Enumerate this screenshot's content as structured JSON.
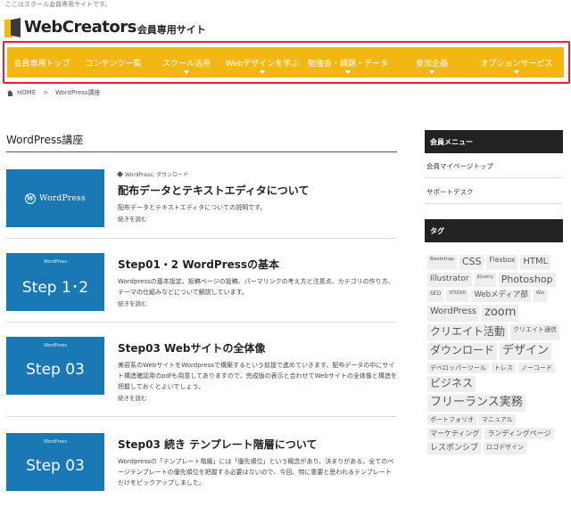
{
  "site": {
    "top_note": "ここはスクール会員専用サイトです。",
    "logo_main": "WebCreators",
    "logo_sub": "会員専用サイト"
  },
  "nav": {
    "items": [
      {
        "label": "会員専用トップ",
        "has_dropdown": false
      },
      {
        "label": "コンテンツ一覧",
        "has_dropdown": false
      },
      {
        "label": "スクール活用",
        "has_dropdown": true
      },
      {
        "label": "Webデザインを学ぶ",
        "has_dropdown": true
      },
      {
        "label": "勉強会・課題・データ",
        "has_dropdown": true
      },
      {
        "label": "参加企画",
        "has_dropdown": true
      },
      {
        "label": "オプションサービス",
        "has_dropdown": true
      }
    ]
  },
  "breadcrumb": {
    "home": "HOME",
    "separator": ">",
    "current": "WordPress講座"
  },
  "main": {
    "page_title": "WordPress講座",
    "articles": [
      {
        "thumb_type": "wordpress-logo",
        "thumb_text": "WordPress",
        "thumb_small": "",
        "categories": "WordPress, ダウンロード",
        "title": "配布データとテキストエディタについて",
        "excerpt": "配布データとテキストエディタについての説明です。",
        "more": "続きを読む"
      },
      {
        "thumb_type": "step",
        "thumb_text": "Step 1･2",
        "thumb_small": "WordPress",
        "categories": "",
        "title": "Step01・2 WordPressの基本",
        "excerpt": "Wordpressの基本設定、投稿ページの投稿、パーマリンクの考え方と注意点、カテゴリの作り方、テーマの仕組みなどについて解説しています。",
        "more": "続きを読む"
      },
      {
        "thumb_type": "step",
        "thumb_text": "Step 03",
        "thumb_small": "WordPress",
        "categories": "",
        "title": "Step03 Webサイトの全体像",
        "excerpt": "美容系のWebサイトをWordpressで構築するという前提で進めていきます。配布データの中にサイト構造確認用のpdfも用意してありますので、完成版の表示と合わせてWebサイトの全体像と構造を把握しておくとよいでしょう。",
        "more": "続きを読む"
      },
      {
        "thumb_type": "step",
        "thumb_text": "Step 03",
        "thumb_small": "WordPress",
        "categories": "",
        "title": "Step03 続き テンプレート階層について",
        "excerpt": "Wordpressの「テンプレート階層」には「優先順位」という概念があり、決まりがある。全てのページテンプレートの優先順位を把握する必要はないので、今回、特に重要と思われるテンプレートだけをピックアップしました。",
        "more": ""
      }
    ]
  },
  "sidebar": {
    "member_menu_title": "会員メニュー",
    "member_links": [
      "会員マイページトップ",
      "サポートデスク"
    ],
    "tags_title": "タグ",
    "tags": [
      {
        "label": "Bootstrap",
        "size": 5.5
      },
      {
        "label": "CSS",
        "size": 11
      },
      {
        "label": "Flexbox",
        "size": 7.5
      },
      {
        "label": "HTML",
        "size": 10
      },
      {
        "label": "Illustrator",
        "size": 9
      },
      {
        "label": "jQuery",
        "size": 5.5
      },
      {
        "label": "Photoshop",
        "size": 11
      },
      {
        "label": "SEO",
        "size": 6
      },
      {
        "label": "STUDIO",
        "size": 5
      },
      {
        "label": "Webメディア部",
        "size": 8.5
      },
      {
        "label": "Wix",
        "size": 5
      },
      {
        "label": "WordPress",
        "size": 10
      },
      {
        "label": "zoom",
        "size": 13
      },
      {
        "label": "クリエイト活動",
        "size": 12
      },
      {
        "label": "クリエイト通信",
        "size": 7
      },
      {
        "label": "ダウンロード",
        "size": 12
      },
      {
        "label": "デザイン",
        "size": 13
      },
      {
        "label": "デベロッパーツール",
        "size": 7
      },
      {
        "label": "トレス",
        "size": 7
      },
      {
        "label": "ノーコード",
        "size": 7
      },
      {
        "label": "ビジネス",
        "size": 12
      },
      {
        "label": "フリーランス実務",
        "size": 13
      },
      {
        "label": "ポートフォリオ",
        "size": 7
      },
      {
        "label": "マニュアル",
        "size": 7
      },
      {
        "label": "マーケティング",
        "size": 8
      },
      {
        "label": "ランディングページ",
        "size": 8
      },
      {
        "label": "レスポンシブ",
        "size": 9
      },
      {
        "label": "ロゴデザイン",
        "size": 7
      }
    ]
  }
}
